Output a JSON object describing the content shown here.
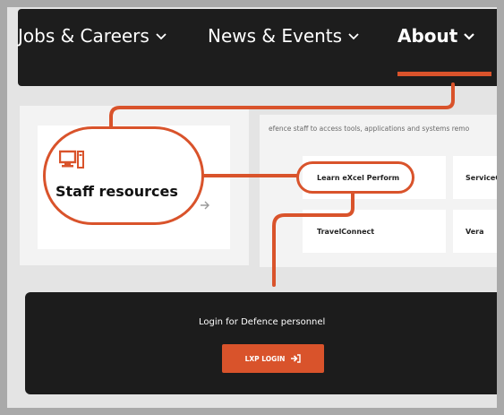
{
  "nav": {
    "items": [
      {
        "label": "Jobs & Careers"
      },
      {
        "label": "News & Events"
      },
      {
        "label": "About"
      }
    ]
  },
  "staff_card": {
    "title": "Staff resources",
    "icon": "computer-icon"
  },
  "resources": {
    "intro": "efence staff to access tools, applications and systems remo",
    "tiles": [
      {
        "label": "Learn eXcel Perform"
      },
      {
        "label": "ServiceCo"
      },
      {
        "label": "TravelConnect"
      },
      {
        "label": "Vera"
      }
    ]
  },
  "login": {
    "title": "Login for Defence personnel",
    "button_label": "LXP LOGIN",
    "button_icon": "sign-in-arrow-icon"
  },
  "colors": {
    "accent": "#d9532b",
    "nav_bg": "#1d1d1d",
    "panel_bg": "#f3f3f3"
  }
}
